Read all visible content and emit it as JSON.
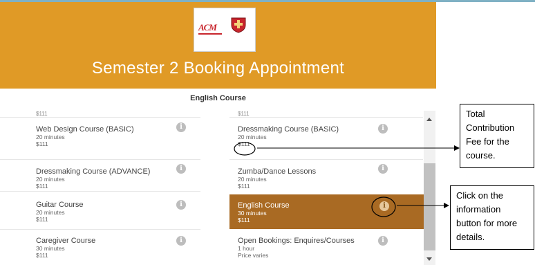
{
  "banner": {
    "logo_text": "ACM",
    "title": "Semester 2 Booking Appointment"
  },
  "section_heading": "English Course",
  "left_column": {
    "partial_top_price": "$111",
    "items": [
      {
        "name": "Web Design Course (BASIC)",
        "duration": "20 minutes",
        "price": "$111"
      },
      {
        "name": "Dressmaking Course (ADVANCE)",
        "duration": "20 minutes",
        "price": "$111"
      },
      {
        "name": "Guitar Course",
        "duration": "20 minutes",
        "price": "$111"
      },
      {
        "name": "Caregiver Course",
        "duration": "30 minutes",
        "price": "$111"
      }
    ]
  },
  "right_column": {
    "partial_top_price": "$111",
    "items": [
      {
        "name": "Dressmaking Course (BASIC)",
        "duration": "20 minutes",
        "price": "$111"
      },
      {
        "name": "Zumba/Dance Lessons",
        "duration": "20 minutes",
        "price": "$111"
      },
      {
        "name": "English Course",
        "duration": "30 minutes",
        "price": "$111",
        "selected": true
      },
      {
        "name": "Open Bookings: Enquires/Courses",
        "duration": "1 hour",
        "price": "Price varies"
      }
    ]
  },
  "info_icon_glyph": "i",
  "callouts": {
    "fee": "Total Contribution Fee for the course.",
    "info": "Click on the information button for more details."
  },
  "colors": {
    "banner": "#e09a26",
    "selected": "#a96a23",
    "info_icon": "#bdbdbd"
  }
}
